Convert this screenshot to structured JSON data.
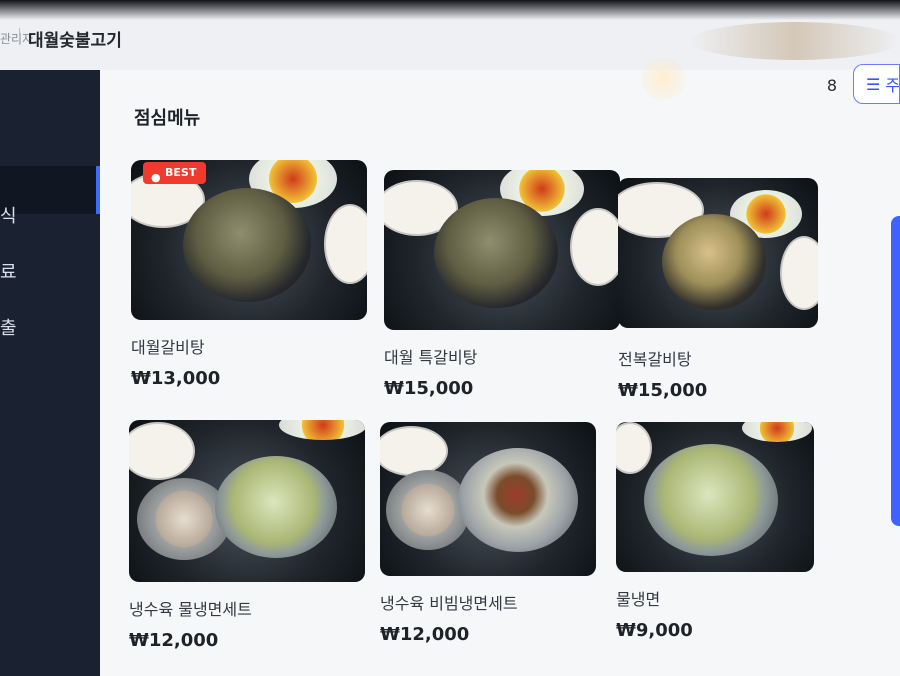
{
  "header": {
    "crumb_prefix": "관리자",
    "store_name": "대월숯불고기",
    "count": "8"
  },
  "sidebar": {
    "items": [
      {
        "label": "식"
      },
      {
        "label": "료"
      },
      {
        "label": "출"
      }
    ]
  },
  "toolbar": {
    "filter_icon": "menu-lines-icon",
    "filter_label": "주"
  },
  "section": {
    "title": "점심메뉴"
  },
  "menu": [
    {
      "name": "대월갈비탕",
      "price": "₩13,000",
      "badge": "BEST"
    },
    {
      "name": "대월 특갈비탕",
      "price": "₩15,000"
    },
    {
      "name": "전복갈비탕",
      "price": "₩15,000"
    },
    {
      "name": "냉수육 물냉면세트",
      "price": "₩12,000"
    },
    {
      "name": "냉수육 비빔냉면세트",
      "price": "₩12,000"
    },
    {
      "name": "물냉면",
      "price": "₩9,000"
    }
  ],
  "colors": {
    "accent": "#3f62ff",
    "badge": "#ef3a2e",
    "sidebar": "#1a2232"
  }
}
